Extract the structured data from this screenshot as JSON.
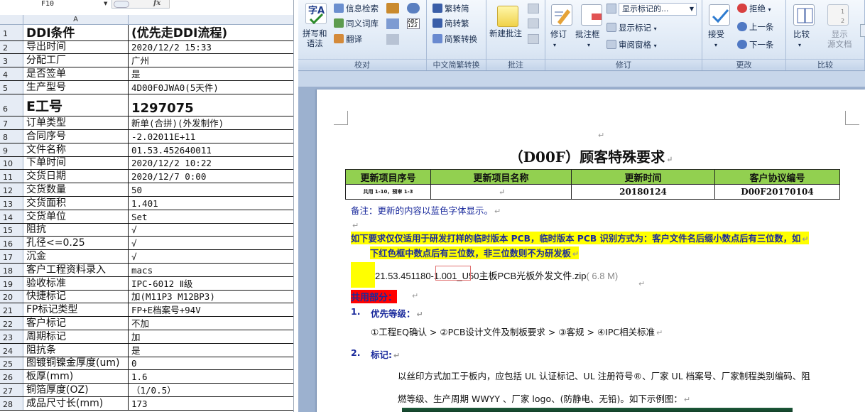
{
  "sheet": {
    "name_box": "F10",
    "formula_icon": "fx",
    "column_header": "A",
    "rows": [
      {
        "n": "1",
        "a": "DDI条件",
        "b": "(优先走DDI流程)",
        "size": "mid"
      },
      {
        "n": "2",
        "a": "导出时间",
        "b": "2020/12/2 15:33"
      },
      {
        "n": "3",
        "a": "分配工厂",
        "b": "广州"
      },
      {
        "n": "4",
        "a": "是否签单",
        "b": "是"
      },
      {
        "n": "5",
        "a": "生产型号",
        "b": "4D00F0JWA0(5天件)"
      },
      {
        "n": "6",
        "a": "E工号",
        "b": "1297075",
        "size": "big"
      },
      {
        "n": "7",
        "a": "订单类型",
        "b": "新单(合拼)(外发制作)"
      },
      {
        "n": "8",
        "a": "合同序号",
        "b": "-2.02011E+11"
      },
      {
        "n": "9",
        "a": "文件名称",
        "b": "01.53.452640011"
      },
      {
        "n": "10",
        "a": "下单时间",
        "b": "2020/12/2 10:22"
      },
      {
        "n": "11",
        "a": "交货日期",
        "b": "2020/12/7 0:00"
      },
      {
        "n": "12",
        "a": "交货数量",
        "b": "50"
      },
      {
        "n": "13",
        "a": "交货面积",
        "b": "1.401"
      },
      {
        "n": "14",
        "a": "交货单位",
        "b": "Set"
      },
      {
        "n": "15",
        "a": "阻抗",
        "b": "√"
      },
      {
        "n": "16",
        "a": "孔径<=0.25",
        "b": "√"
      },
      {
        "n": "17",
        "a": "沉金",
        "b": "√"
      },
      {
        "n": "18",
        "a": "客户工程资料录入",
        "b": "macs"
      },
      {
        "n": "19",
        "a": "验收标准",
        "b": "IPC-6012 Ⅱ级"
      },
      {
        "n": "20",
        "a": "快捷标记",
        "b": "加(M11P3 M12BP3)"
      },
      {
        "n": "21",
        "a": "FP标记类型",
        "b": "FP+E档案号+94V"
      },
      {
        "n": "22",
        "a": "客户标记",
        "b": "不加"
      },
      {
        "n": "23",
        "a": "周期标记",
        "b": "加"
      },
      {
        "n": "24",
        "a": "阻抗条",
        "b": "是"
      },
      {
        "n": "25",
        "a": "图镀铜镍金厚度(um)",
        "b": "0"
      },
      {
        "n": "26",
        "a": "板厚(mm)",
        "b": "1.6"
      },
      {
        "n": "27",
        "a": "铜箔厚度(OZ)",
        "b": "（1/0.5）"
      },
      {
        "n": "28",
        "a": "成品尺寸长(mm)",
        "b": "173"
      }
    ]
  },
  "ribbon": {
    "groups": {
      "proof": {
        "label": "校对",
        "spell": "拼写和\n语法",
        "research": "信息检索",
        "thesaurus": "同义词库",
        "translate": "翻译"
      },
      "chinese": {
        "label": "中文简繁转换",
        "to_simplified": "繁转简",
        "to_traditional": "简转繁",
        "conversion": "简繁转换"
      },
      "comments": {
        "label": "批注",
        "new_comment": "新建批注"
      },
      "tracking": {
        "label": "修订",
        "track": "修订",
        "balloons": "批注框",
        "display_combo": "显示标记的...",
        "show_markup": "显示标记",
        "reviewing_pane": "审阅窗格"
      },
      "changes": {
        "label": "更改",
        "accept": "接受",
        "reject": "拒绝",
        "previous": "上一条",
        "next": "下一条"
      },
      "compare": {
        "label": "比较",
        "compare": "比较",
        "show_source": "显示\n源文档"
      }
    }
  },
  "document": {
    "title": "（D00F）顾客特殊要求",
    "table": {
      "headers": [
        "更新项目序号",
        "更新项目名称",
        "更新时间",
        "客户协议编号"
      ],
      "row": [
        "共用 1-10，预审 1-3",
        "",
        "20180124",
        "D00F20170104"
      ]
    },
    "note": "备注：更新的内容以蓝色字体显示。",
    "requirement_line1": "如下要求仅仅适用于研发打样的临时版本 PCB，临时版本 PCB 识别方式为：客户文件名后缀小数点后有三位数，如",
    "requirement_line2": "下红色框中数点后有三位数，非三位数则不为研发板",
    "file_name": "21.53.451180-1.001_U50主板PCB光板外发文件.zip",
    "file_size": "( 6.8 M)",
    "section_common": "共用部分：",
    "item1_num": "1.",
    "item1_title": "优先等级：",
    "item1_body": "①工程EQ确认 > ②PCB设计文件及制板要求 > ③客规 > ④IPC相关标准",
    "item2_num": "2.",
    "item2_title": "标记:",
    "item2_body1": "以丝印方式加工于板内，应包括 UL 认证标记、UL 注册符号®、厂家 UL 档案号、厂家制程类别编码、阻",
    "item2_body2": "燃等级、生产周期 WWYY 、厂家 logo、(防静电、无铅)。如下示例图："
  }
}
